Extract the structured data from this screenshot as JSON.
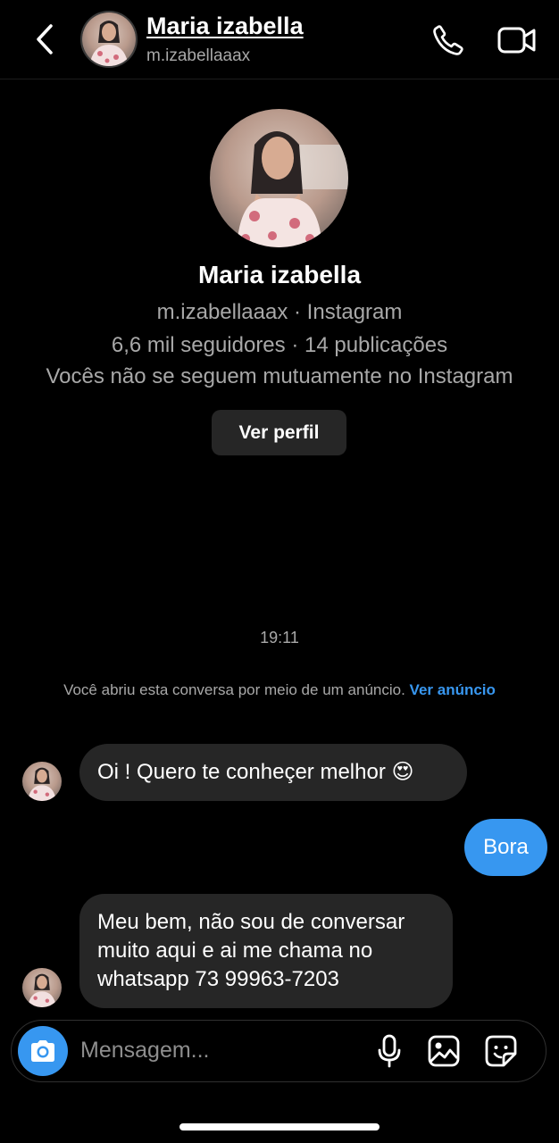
{
  "header": {
    "contact_name": "Maria izabella",
    "contact_username": "m.izabellaaax",
    "icons": {
      "back": "chevron-left-icon",
      "call": "phone-icon",
      "video": "video-camera-icon"
    }
  },
  "profile": {
    "name": "Maria izabella",
    "username_platform": "m.izabellaaax · Instagram",
    "stats": "6,6 mil seguidores · 14 publicações",
    "follow_status": "Vocês não se seguem mutuamente no Instagram",
    "view_profile_label": "Ver perfil"
  },
  "conversation": {
    "timestamp": "19:11",
    "ad_notice": "Você abriu esta conversa por meio de um anúncio.",
    "ad_link": "Ver anúncio",
    "messages": [
      {
        "from": "them",
        "text": "Oi ! Quero te conheçer melhor 😍"
      },
      {
        "from": "me",
        "text": "Bora"
      },
      {
        "from": "them",
        "text": "Meu bem, não sou de conversar muito aqui e ai me chama no whatsapp 73 99963-7203"
      }
    ]
  },
  "composer": {
    "placeholder": "Mensagem...",
    "icons": {
      "camera": "camera-icon",
      "mic": "microphone-icon",
      "gallery": "image-icon",
      "sticker": "sticker-icon"
    }
  },
  "colors": {
    "accent": "#3797f0",
    "bubble_in": "#262626",
    "background": "#000000",
    "secondary_text": "#a8a8a8"
  }
}
